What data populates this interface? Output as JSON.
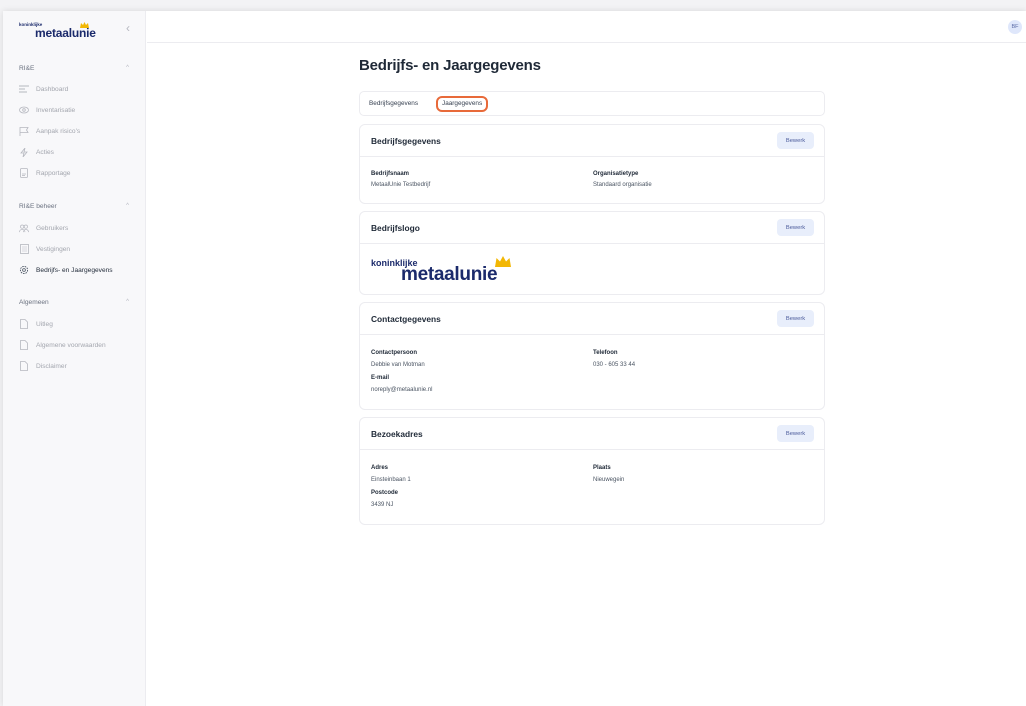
{
  "sidebar": {
    "logo_small": "koninklijke",
    "logo_main": "metaalunie",
    "sections": [
      {
        "title": "RI&E",
        "items": [
          {
            "label": "Dashboard",
            "icon": "dashboard-icon"
          },
          {
            "label": "Inventarisatie",
            "icon": "eye-icon"
          },
          {
            "label": "Aanpak risico's",
            "icon": "flag-icon"
          },
          {
            "label": "Acties",
            "icon": "lightning-icon"
          },
          {
            "label": "Rapportage",
            "icon": "report-icon"
          }
        ]
      },
      {
        "title": "RI&E beheer",
        "items": [
          {
            "label": "Gebruikers",
            "icon": "users-icon"
          },
          {
            "label": "Vestigingen",
            "icon": "building-icon"
          },
          {
            "label": "Bedrijfs- en Jaargegevens",
            "icon": "gear-icon"
          }
        ]
      },
      {
        "title": "Algemeen",
        "items": [
          {
            "label": "Uitleg",
            "icon": "document-icon"
          },
          {
            "label": "Algemene voorwaarden",
            "icon": "document-icon"
          },
          {
            "label": "Disclaimer",
            "icon": "document-icon"
          }
        ]
      }
    ]
  },
  "header": {
    "avatar_initials": "BF"
  },
  "main": {
    "title": "Bedrijfs- en Jaargegevens",
    "tabs": [
      {
        "label": "Bedrijfsgegevens"
      },
      {
        "label": "Jaargegevens"
      }
    ],
    "edit_label": "Bewerk",
    "cards": {
      "company": {
        "title": "Bedrijfsgegevens",
        "fields": [
          {
            "label": "Bedrijfsnaam",
            "value": "MetaalUnie Testbedrijf"
          },
          {
            "label": "Organisatietype",
            "value": "Standaard organisatie"
          }
        ]
      },
      "logo": {
        "title": "Bedrijfslogo",
        "logo_small": "koninklijke",
        "logo_main": "metaalunie"
      },
      "contact": {
        "title": "Contactgegevens",
        "fields": [
          {
            "label": "Contactpersoon",
            "value": "Debbie van Motman"
          },
          {
            "label": "Telefoon",
            "value": "030 - 605 33 44"
          },
          {
            "label": "E-mail",
            "value": "noreply@metaalunie.nl"
          }
        ]
      },
      "address": {
        "title": "Bezoekadres",
        "fields": [
          {
            "label": "Adres",
            "value": "Einsteinbaan 1"
          },
          {
            "label": "Plaats",
            "value": "Nieuwegein"
          },
          {
            "label": "Postcode",
            "value": "3439 NJ"
          }
        ]
      }
    }
  },
  "colors": {
    "accent": "#e86a3a",
    "brand": "#1b2a6b",
    "crown": "#f2b705",
    "button_bg": "#e8eefb"
  }
}
